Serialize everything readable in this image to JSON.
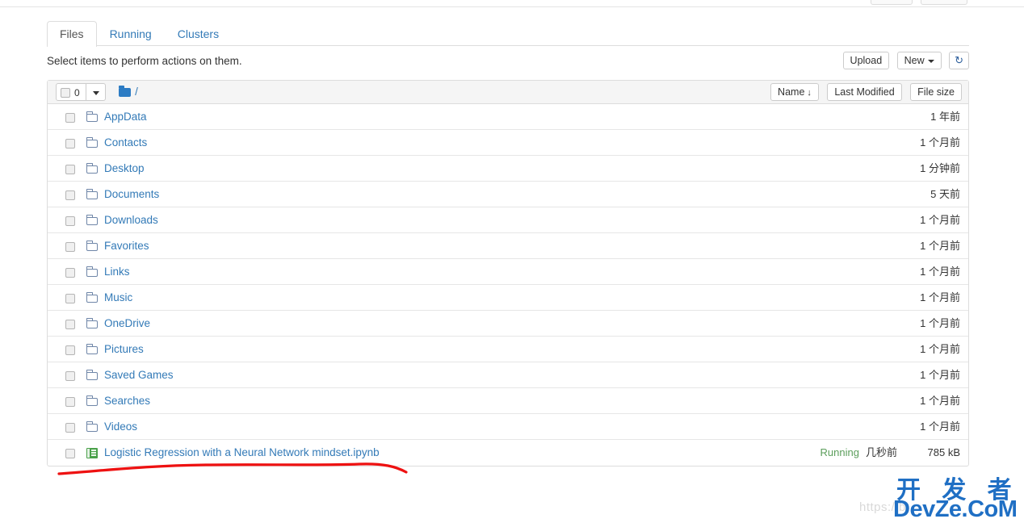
{
  "top_stub_buttons": [
    "",
    ""
  ],
  "tabs": [
    {
      "label": "Files",
      "active": true
    },
    {
      "label": "Running",
      "active": false
    },
    {
      "label": "Clusters",
      "active": false
    }
  ],
  "toolbar": {
    "note": "Select items to perform actions on them.",
    "upload_label": "Upload",
    "new_label": "New",
    "refresh_icon": "refresh-icon",
    "refresh_glyph": "↻"
  },
  "list_header": {
    "selected_count": "0",
    "select_all_icon": "checkbox-icon",
    "dropdown_icon": "caret-down-icon",
    "breadcrumb_folder_icon": "folder-icon",
    "breadcrumb_path": "/",
    "sort_name": "Name",
    "sort_name_arrow": "↓",
    "sort_last_modified": "Last Modified",
    "sort_file_size": "File size"
  },
  "rows": [
    {
      "name": "AppData",
      "icon": "folder-icon",
      "type": "folder",
      "modified": "1 年前",
      "size": "",
      "status": ""
    },
    {
      "name": "Contacts",
      "icon": "folder-icon",
      "type": "folder",
      "modified": "1 个月前",
      "size": "",
      "status": ""
    },
    {
      "name": "Desktop",
      "icon": "folder-icon",
      "type": "folder",
      "modified": "1 分钟前",
      "size": "",
      "status": ""
    },
    {
      "name": "Documents",
      "icon": "folder-icon",
      "type": "folder",
      "modified": "5 天前",
      "size": "",
      "status": ""
    },
    {
      "name": "Downloads",
      "icon": "folder-icon",
      "type": "folder",
      "modified": "1 个月前",
      "size": "",
      "status": ""
    },
    {
      "name": "Favorites",
      "icon": "folder-icon",
      "type": "folder",
      "modified": "1 个月前",
      "size": "",
      "status": ""
    },
    {
      "name": "Links",
      "icon": "folder-icon",
      "type": "folder",
      "modified": "1 个月前",
      "size": "",
      "status": ""
    },
    {
      "name": "Music",
      "icon": "folder-icon",
      "type": "folder",
      "modified": "1 个月前",
      "size": "",
      "status": ""
    },
    {
      "name": "OneDrive",
      "icon": "folder-icon",
      "type": "folder",
      "modified": "1 个月前",
      "size": "",
      "status": ""
    },
    {
      "name": "Pictures",
      "icon": "folder-icon",
      "type": "folder",
      "modified": "1 个月前",
      "size": "",
      "status": ""
    },
    {
      "name": "Saved Games",
      "icon": "folder-icon",
      "type": "folder",
      "modified": "1 个月前",
      "size": "",
      "status": ""
    },
    {
      "name": "Searches",
      "icon": "folder-icon",
      "type": "folder",
      "modified": "1 个月前",
      "size": "",
      "status": ""
    },
    {
      "name": "Videos",
      "icon": "folder-icon",
      "type": "folder",
      "modified": "1 个月前",
      "size": "",
      "status": ""
    },
    {
      "name": "Logistic Regression with a Neural Network mindset.ipynb",
      "icon": "notebook-icon",
      "type": "notebook",
      "modified": "几秒前",
      "size": "785 kB",
      "status": "Running"
    }
  ],
  "annotation": {
    "type": "hand-drawn-underline",
    "color": "#ee1111"
  },
  "watermark": {
    "chinese": "开 发 者",
    "english": "DevZe.CoM",
    "url_faint": "https://b",
    "color": "#1f6fc4"
  },
  "colors": {
    "link": "#337ab7",
    "running_green": "#5b9e5b",
    "folder_outline": "#6f86a8",
    "notebook_green": "#4aa14a",
    "annotation_red": "#ee1111"
  }
}
